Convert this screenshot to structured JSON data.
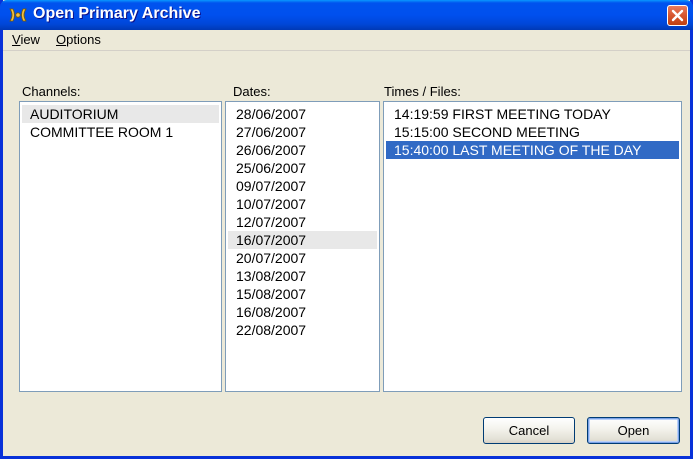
{
  "window": {
    "title": "Open Primary Archive"
  },
  "menu": {
    "view": "View",
    "view_u": "V",
    "view_rest": "iew",
    "options": "Options",
    "options_u": "O",
    "options_rest": "ptions"
  },
  "channels": {
    "label": "Channels:",
    "items": [
      "AUDITORIUM",
      "COMMITTEE ROOM 1"
    ]
  },
  "dates": {
    "label": "Dates:",
    "items": [
      "28/06/2007",
      "27/06/2007",
      "26/06/2007",
      "25/06/2007",
      "09/07/2007",
      "10/07/2007",
      "12/07/2007",
      "16/07/2007",
      "20/07/2007",
      "13/08/2007",
      "15/08/2007",
      "16/08/2007",
      "22/08/2007"
    ]
  },
  "times": {
    "label": "Times / Files:",
    "items": [
      "14:19:59  FIRST MEETING TODAY",
      "15:15:00  SECOND MEETING",
      "15:40:00  LAST MEETING OF THE DAY"
    ],
    "selected_index": 2
  },
  "buttons": {
    "cancel": "Cancel",
    "open": "Open"
  },
  "colors": {
    "selection": "#316ac5",
    "titlebar": "#0050ee",
    "close": "#d65630"
  }
}
